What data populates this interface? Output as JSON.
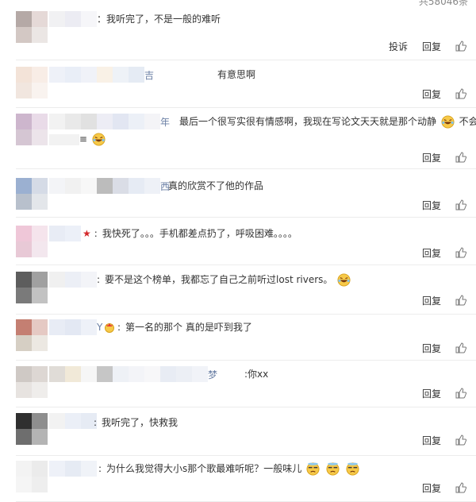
{
  "total_label": "共58046条",
  "actions": {
    "report": "投诉",
    "reply": "回复"
  },
  "comments": [
    {
      "text": "：我听完了，不是一般的难听",
      "tail": ""
    },
    {
      "text": "有意思啊",
      "tail": "",
      "name_tail": "吉"
    },
    {
      "text": "最后一个很写实很有情感啊，我现在写论文天天就是那个动静",
      "tail": "不会",
      "name_tail": "年",
      "line2_start": "≡"
    },
    {
      "text": "真的欣赏不了他的作品",
      "tail": "",
      "name_tail": "西"
    },
    {
      "text": "我快死了。。。手机都差点扔了，呼吸困难。。。。",
      "tail": ""
    },
    {
      "text": "要不是这个榜单，我都忘了自己之前听过lost rivers。",
      "tail": ""
    },
    {
      "text": "第一名的那个 真的是吓到我了",
      "tail": "",
      "name_tail": "Y"
    },
    {
      "text": "你xx",
      "tail": "",
      "name_tail": "梦"
    },
    {
      "text": "我听完了，快救我",
      "tail": ""
    },
    {
      "text": "为什么我觉得大小s那个歌最难听呢？一般味儿",
      "tail": ""
    }
  ],
  "colors": {
    "text": "#333333",
    "muted": "#888888",
    "divider": "#ececec",
    "star": "#d4282b",
    "emoji": "#f7c948"
  },
  "icons": {
    "like": "thumbs-up-icon",
    "laugh": "laughing-emoji-icon",
    "sweat": "sweat-emoji-icon",
    "crown": "crown-emoji-icon",
    "star": "star-icon"
  }
}
